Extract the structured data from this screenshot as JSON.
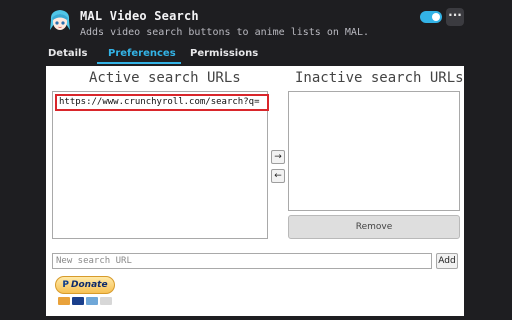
{
  "header": {
    "title": "MAL Video Search",
    "subtitle": "Adds video search buttons to anime lists on MAL.",
    "logo_icon": "anime-girl-icon",
    "toggle_on": true,
    "more_label": "···"
  },
  "tabs": [
    {
      "label": "Details",
      "active": false
    },
    {
      "label": "Preferences",
      "active": true
    },
    {
      "label": "Permissions",
      "active": false
    }
  ],
  "preferences": {
    "active_title": "Active search URLs",
    "inactive_title": "Inactive search URLs",
    "active_urls": [
      "https://www.crunchyroll.com/search?q="
    ],
    "inactive_urls": [],
    "move_right_label": "→",
    "move_left_label": "←",
    "remove_label": "Remove",
    "new_url_placeholder": "New search URL",
    "new_url_value": "",
    "add_label": "Add",
    "donate_label": "Donate",
    "donate_brand": "P"
  },
  "colors": {
    "accent": "#33b3e6",
    "background": "#1e1e21",
    "highlight": "#d9262b"
  }
}
